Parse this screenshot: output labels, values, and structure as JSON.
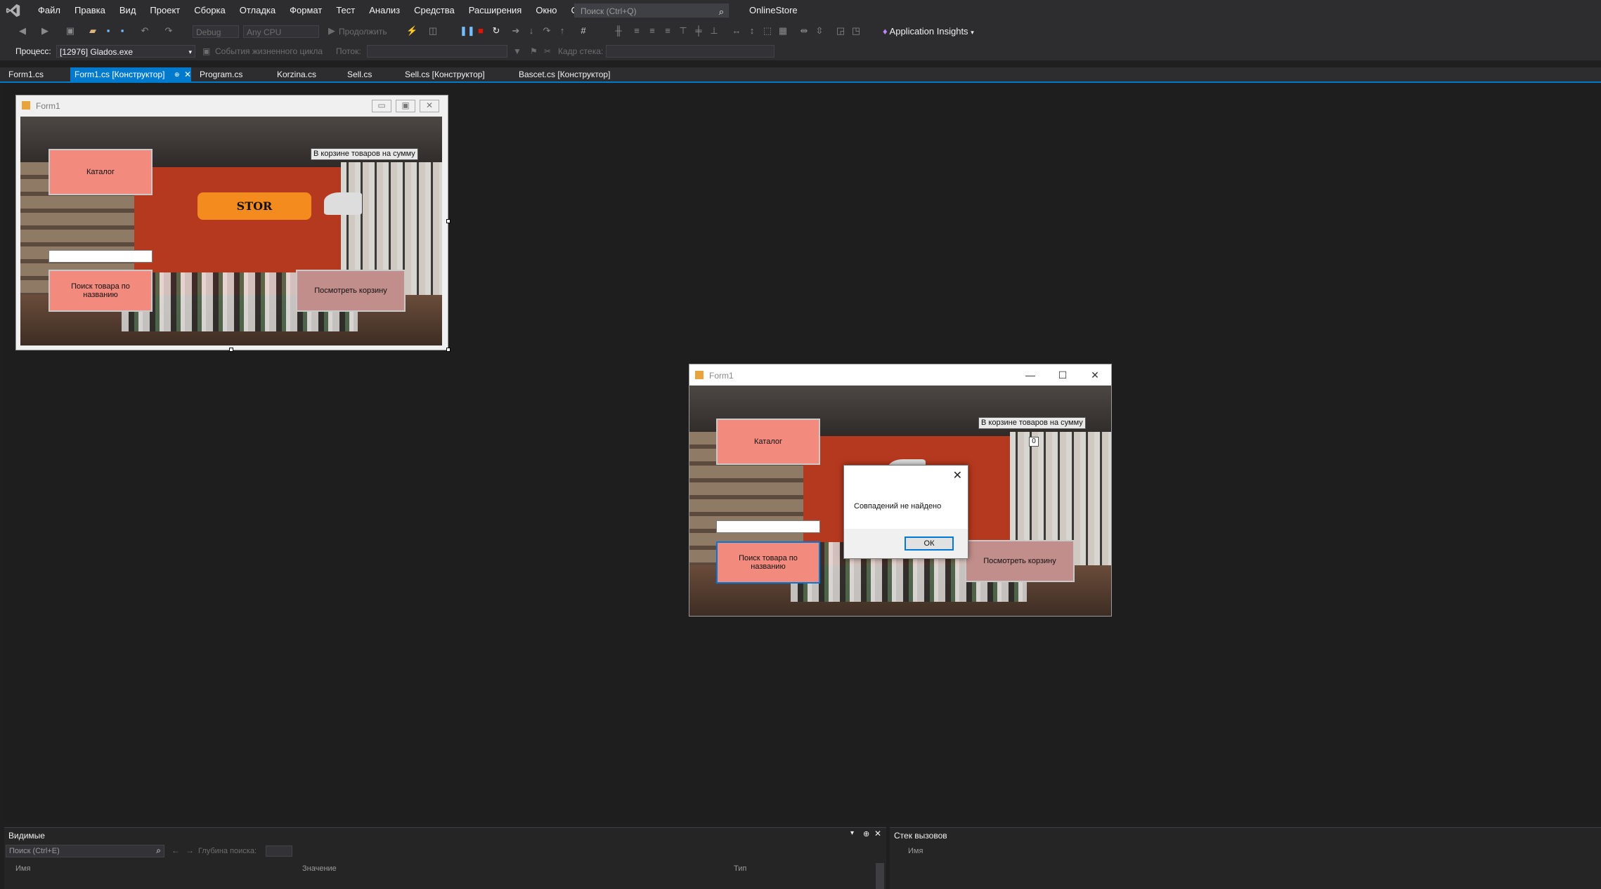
{
  "menubar": {
    "items": [
      "Файл",
      "Правка",
      "Вид",
      "Проект",
      "Сборка",
      "Отладка",
      "Формат",
      "Тест",
      "Анализ",
      "Средства",
      "Расширения",
      "Окно",
      "Справка"
    ],
    "search_placeholder": "Поиск (Ctrl+Q)",
    "solution_name": "OnlineStore"
  },
  "toolbar": {
    "config": "Debug",
    "platform": "Any CPU",
    "continue_label": "Продолжить",
    "app_insights": "Application Insights"
  },
  "process_bar": {
    "process_label": "Процесс:",
    "process_value": "[12976] Glados.exe",
    "lifecycle_label": "События жизненного цикла",
    "thread_label": "Поток:",
    "stack_frame_label": "Кадр стека:"
  },
  "tabs": [
    {
      "label": "Form1.cs",
      "active": false
    },
    {
      "label": "Form1.cs [Конструктор]",
      "active": true
    },
    {
      "label": "Program.cs",
      "active": false
    },
    {
      "label": "Korzina.cs",
      "active": false
    },
    {
      "label": "Sell.cs",
      "active": false
    },
    {
      "label": "Sell.cs [Конструктор]",
      "active": false
    },
    {
      "label": "Bascet.cs [Конструктор]",
      "active": false
    }
  ],
  "designer_form": {
    "title": "Form1",
    "catalog_button": "Каталог",
    "basket_label": "В корзине товаров на сумму",
    "search_button": "Поиск товара по названию",
    "view_basket_button": "Посмотреть корзину",
    "logo_text": "STOR"
  },
  "running_form": {
    "title": "Form1",
    "catalog_button": "Каталог",
    "basket_label": "В корзине товаров на сумму",
    "basket_value": "0",
    "search_button": "Поиск товара по названию",
    "view_basket_button": "Посмотреть корзину"
  },
  "message_box": {
    "text": "Совпадений не найдено",
    "ok_label": "ОК"
  },
  "locals_panel": {
    "title": "Видимые",
    "search_placeholder": "Поиск (Ctrl+E)",
    "depth_label": "Глубина поиска:",
    "columns": [
      "Имя",
      "Значение",
      "Тип"
    ]
  },
  "callstack_panel": {
    "title": "Стек вызовов",
    "columns": [
      "Имя"
    ]
  },
  "colors": {
    "accent": "#007acc",
    "chrome": "#2d2d30",
    "button_coral": "#f28b7e",
    "button_pink": "#c28e8b"
  }
}
